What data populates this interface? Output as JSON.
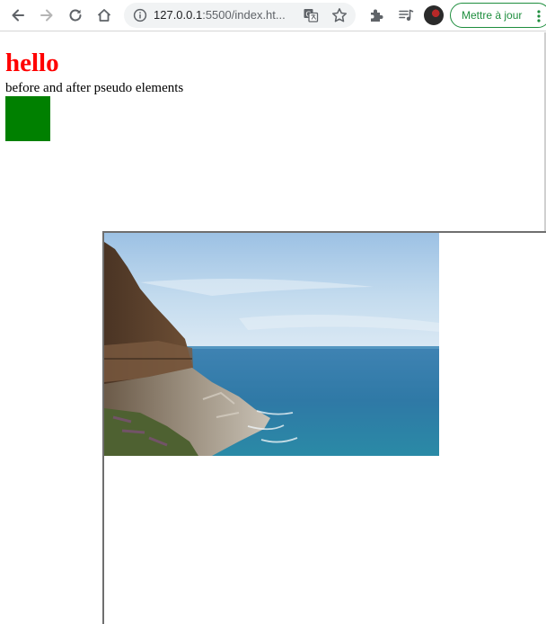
{
  "browser": {
    "url_host": "127.0.0.1",
    "url_rest": ":5500/index.ht...",
    "update_button_label": "Mettre à jour"
  },
  "page": {
    "heading": "hello",
    "subtitle": "before and after pseudo elements",
    "heading_color": "#ff0000",
    "box_color": "#008000"
  },
  "image": {
    "description": "coastal-cliff-ocean-photo"
  },
  "icons": {
    "back": "back-arrow-icon",
    "forward": "forward-arrow-icon",
    "reload": "reload-icon",
    "home": "home-icon",
    "info": "info-icon",
    "translate": "translate-icon",
    "star": "star-icon",
    "extensions": "puzzle-icon",
    "media": "playlist-icon",
    "menu": "kebab-menu-icon"
  }
}
